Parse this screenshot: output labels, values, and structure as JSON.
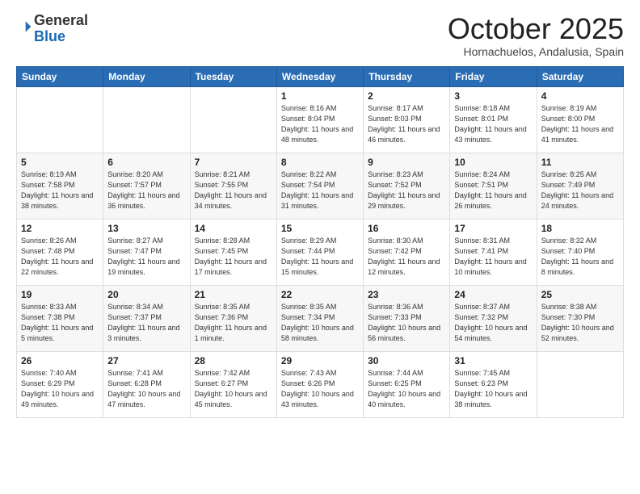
{
  "logo": {
    "general": "General",
    "blue": "Blue"
  },
  "header": {
    "month": "October 2025",
    "location": "Hornachuelos, Andalusia, Spain"
  },
  "weekdays": [
    "Sunday",
    "Monday",
    "Tuesday",
    "Wednesday",
    "Thursday",
    "Friday",
    "Saturday"
  ],
  "weeks": [
    [
      {
        "day": "",
        "info": ""
      },
      {
        "day": "",
        "info": ""
      },
      {
        "day": "",
        "info": ""
      },
      {
        "day": "1",
        "info": "Sunrise: 8:16 AM\nSunset: 8:04 PM\nDaylight: 11 hours\nand 48 minutes."
      },
      {
        "day": "2",
        "info": "Sunrise: 8:17 AM\nSunset: 8:03 PM\nDaylight: 11 hours\nand 46 minutes."
      },
      {
        "day": "3",
        "info": "Sunrise: 8:18 AM\nSunset: 8:01 PM\nDaylight: 11 hours\nand 43 minutes."
      },
      {
        "day": "4",
        "info": "Sunrise: 8:19 AM\nSunset: 8:00 PM\nDaylight: 11 hours\nand 41 minutes."
      }
    ],
    [
      {
        "day": "5",
        "info": "Sunrise: 8:19 AM\nSunset: 7:58 PM\nDaylight: 11 hours\nand 38 minutes."
      },
      {
        "day": "6",
        "info": "Sunrise: 8:20 AM\nSunset: 7:57 PM\nDaylight: 11 hours\nand 36 minutes."
      },
      {
        "day": "7",
        "info": "Sunrise: 8:21 AM\nSunset: 7:55 PM\nDaylight: 11 hours\nand 34 minutes."
      },
      {
        "day": "8",
        "info": "Sunrise: 8:22 AM\nSunset: 7:54 PM\nDaylight: 11 hours\nand 31 minutes."
      },
      {
        "day": "9",
        "info": "Sunrise: 8:23 AM\nSunset: 7:52 PM\nDaylight: 11 hours\nand 29 minutes."
      },
      {
        "day": "10",
        "info": "Sunrise: 8:24 AM\nSunset: 7:51 PM\nDaylight: 11 hours\nand 26 minutes."
      },
      {
        "day": "11",
        "info": "Sunrise: 8:25 AM\nSunset: 7:49 PM\nDaylight: 11 hours\nand 24 minutes."
      }
    ],
    [
      {
        "day": "12",
        "info": "Sunrise: 8:26 AM\nSunset: 7:48 PM\nDaylight: 11 hours\nand 22 minutes."
      },
      {
        "day": "13",
        "info": "Sunrise: 8:27 AM\nSunset: 7:47 PM\nDaylight: 11 hours\nand 19 minutes."
      },
      {
        "day": "14",
        "info": "Sunrise: 8:28 AM\nSunset: 7:45 PM\nDaylight: 11 hours\nand 17 minutes."
      },
      {
        "day": "15",
        "info": "Sunrise: 8:29 AM\nSunset: 7:44 PM\nDaylight: 11 hours\nand 15 minutes."
      },
      {
        "day": "16",
        "info": "Sunrise: 8:30 AM\nSunset: 7:42 PM\nDaylight: 11 hours\nand 12 minutes."
      },
      {
        "day": "17",
        "info": "Sunrise: 8:31 AM\nSunset: 7:41 PM\nDaylight: 11 hours\nand 10 minutes."
      },
      {
        "day": "18",
        "info": "Sunrise: 8:32 AM\nSunset: 7:40 PM\nDaylight: 11 hours\nand 8 minutes."
      }
    ],
    [
      {
        "day": "19",
        "info": "Sunrise: 8:33 AM\nSunset: 7:38 PM\nDaylight: 11 hours\nand 5 minutes."
      },
      {
        "day": "20",
        "info": "Sunrise: 8:34 AM\nSunset: 7:37 PM\nDaylight: 11 hours\nand 3 minutes."
      },
      {
        "day": "21",
        "info": "Sunrise: 8:35 AM\nSunset: 7:36 PM\nDaylight: 11 hours\nand 1 minute."
      },
      {
        "day": "22",
        "info": "Sunrise: 8:35 AM\nSunset: 7:34 PM\nDaylight: 10 hours\nand 58 minutes."
      },
      {
        "day": "23",
        "info": "Sunrise: 8:36 AM\nSunset: 7:33 PM\nDaylight: 10 hours\nand 56 minutes."
      },
      {
        "day": "24",
        "info": "Sunrise: 8:37 AM\nSunset: 7:32 PM\nDaylight: 10 hours\nand 54 minutes."
      },
      {
        "day": "25",
        "info": "Sunrise: 8:38 AM\nSunset: 7:30 PM\nDaylight: 10 hours\nand 52 minutes."
      }
    ],
    [
      {
        "day": "26",
        "info": "Sunrise: 7:40 AM\nSunset: 6:29 PM\nDaylight: 10 hours\nand 49 minutes."
      },
      {
        "day": "27",
        "info": "Sunrise: 7:41 AM\nSunset: 6:28 PM\nDaylight: 10 hours\nand 47 minutes."
      },
      {
        "day": "28",
        "info": "Sunrise: 7:42 AM\nSunset: 6:27 PM\nDaylight: 10 hours\nand 45 minutes."
      },
      {
        "day": "29",
        "info": "Sunrise: 7:43 AM\nSunset: 6:26 PM\nDaylight: 10 hours\nand 43 minutes."
      },
      {
        "day": "30",
        "info": "Sunrise: 7:44 AM\nSunset: 6:25 PM\nDaylight: 10 hours\nand 40 minutes."
      },
      {
        "day": "31",
        "info": "Sunrise: 7:45 AM\nSunset: 6:23 PM\nDaylight: 10 hours\nand 38 minutes."
      },
      {
        "day": "",
        "info": ""
      }
    ]
  ]
}
